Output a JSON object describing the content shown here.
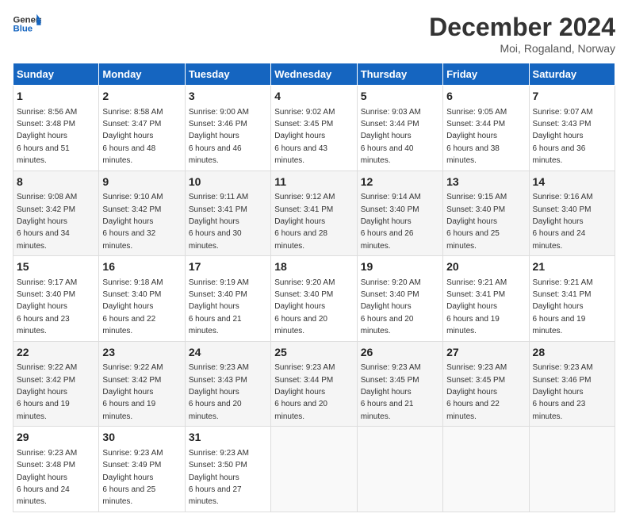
{
  "header": {
    "logo_general": "General",
    "logo_blue": "Blue",
    "title": "December 2024",
    "subtitle": "Moi, Rogaland, Norway"
  },
  "days_of_week": [
    "Sunday",
    "Monday",
    "Tuesday",
    "Wednesday",
    "Thursday",
    "Friday",
    "Saturday"
  ],
  "weeks": [
    [
      {
        "day": 1,
        "sunrise": "8:56 AM",
        "sunset": "3:48 PM",
        "daylight": "6 hours and 51 minutes."
      },
      {
        "day": 2,
        "sunrise": "8:58 AM",
        "sunset": "3:47 PM",
        "daylight": "6 hours and 48 minutes."
      },
      {
        "day": 3,
        "sunrise": "9:00 AM",
        "sunset": "3:46 PM",
        "daylight": "6 hours and 46 minutes."
      },
      {
        "day": 4,
        "sunrise": "9:02 AM",
        "sunset": "3:45 PM",
        "daylight": "6 hours and 43 minutes."
      },
      {
        "day": 5,
        "sunrise": "9:03 AM",
        "sunset": "3:44 PM",
        "daylight": "6 hours and 40 minutes."
      },
      {
        "day": 6,
        "sunrise": "9:05 AM",
        "sunset": "3:44 PM",
        "daylight": "6 hours and 38 minutes."
      },
      {
        "day": 7,
        "sunrise": "9:07 AM",
        "sunset": "3:43 PM",
        "daylight": "6 hours and 36 minutes."
      }
    ],
    [
      {
        "day": 8,
        "sunrise": "9:08 AM",
        "sunset": "3:42 PM",
        "daylight": "6 hours and 34 minutes."
      },
      {
        "day": 9,
        "sunrise": "9:10 AM",
        "sunset": "3:42 PM",
        "daylight": "6 hours and 32 minutes."
      },
      {
        "day": 10,
        "sunrise": "9:11 AM",
        "sunset": "3:41 PM",
        "daylight": "6 hours and 30 minutes."
      },
      {
        "day": 11,
        "sunrise": "9:12 AM",
        "sunset": "3:41 PM",
        "daylight": "6 hours and 28 minutes."
      },
      {
        "day": 12,
        "sunrise": "9:14 AM",
        "sunset": "3:40 PM",
        "daylight": "6 hours and 26 minutes."
      },
      {
        "day": 13,
        "sunrise": "9:15 AM",
        "sunset": "3:40 PM",
        "daylight": "6 hours and 25 minutes."
      },
      {
        "day": 14,
        "sunrise": "9:16 AM",
        "sunset": "3:40 PM",
        "daylight": "6 hours and 24 minutes."
      }
    ],
    [
      {
        "day": 15,
        "sunrise": "9:17 AM",
        "sunset": "3:40 PM",
        "daylight": "6 hours and 23 minutes."
      },
      {
        "day": 16,
        "sunrise": "9:18 AM",
        "sunset": "3:40 PM",
        "daylight": "6 hours and 22 minutes."
      },
      {
        "day": 17,
        "sunrise": "9:19 AM",
        "sunset": "3:40 PM",
        "daylight": "6 hours and 21 minutes."
      },
      {
        "day": 18,
        "sunrise": "9:20 AM",
        "sunset": "3:40 PM",
        "daylight": "6 hours and 20 minutes."
      },
      {
        "day": 19,
        "sunrise": "9:20 AM",
        "sunset": "3:40 PM",
        "daylight": "6 hours and 20 minutes."
      },
      {
        "day": 20,
        "sunrise": "9:21 AM",
        "sunset": "3:41 PM",
        "daylight": "6 hours and 19 minutes."
      },
      {
        "day": 21,
        "sunrise": "9:21 AM",
        "sunset": "3:41 PM",
        "daylight": "6 hours and 19 minutes."
      }
    ],
    [
      {
        "day": 22,
        "sunrise": "9:22 AM",
        "sunset": "3:42 PM",
        "daylight": "6 hours and 19 minutes."
      },
      {
        "day": 23,
        "sunrise": "9:22 AM",
        "sunset": "3:42 PM",
        "daylight": "6 hours and 19 minutes."
      },
      {
        "day": 24,
        "sunrise": "9:23 AM",
        "sunset": "3:43 PM",
        "daylight": "6 hours and 20 minutes."
      },
      {
        "day": 25,
        "sunrise": "9:23 AM",
        "sunset": "3:44 PM",
        "daylight": "6 hours and 20 minutes."
      },
      {
        "day": 26,
        "sunrise": "9:23 AM",
        "sunset": "3:45 PM",
        "daylight": "6 hours and 21 minutes."
      },
      {
        "day": 27,
        "sunrise": "9:23 AM",
        "sunset": "3:45 PM",
        "daylight": "6 hours and 22 minutes."
      },
      {
        "day": 28,
        "sunrise": "9:23 AM",
        "sunset": "3:46 PM",
        "daylight": "6 hours and 23 minutes."
      }
    ],
    [
      {
        "day": 29,
        "sunrise": "9:23 AM",
        "sunset": "3:48 PM",
        "daylight": "6 hours and 24 minutes."
      },
      {
        "day": 30,
        "sunrise": "9:23 AM",
        "sunset": "3:49 PM",
        "daylight": "6 hours and 25 minutes."
      },
      {
        "day": 31,
        "sunrise": "9:23 AM",
        "sunset": "3:50 PM",
        "daylight": "6 hours and 27 minutes."
      },
      null,
      null,
      null,
      null
    ]
  ]
}
